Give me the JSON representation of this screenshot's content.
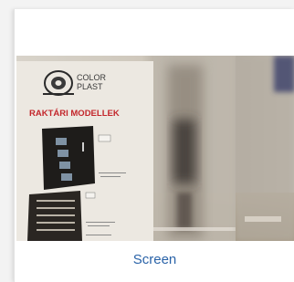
{
  "photo": {
    "brand_line1": "COLOR",
    "brand_line2": "PLAST",
    "heading": "RAKTÁRI MODELLEK"
  },
  "caption": "Screen",
  "colors": {
    "caption": "#2a63a8",
    "heading": "#c3262b",
    "panel": "#1e1c1a"
  }
}
